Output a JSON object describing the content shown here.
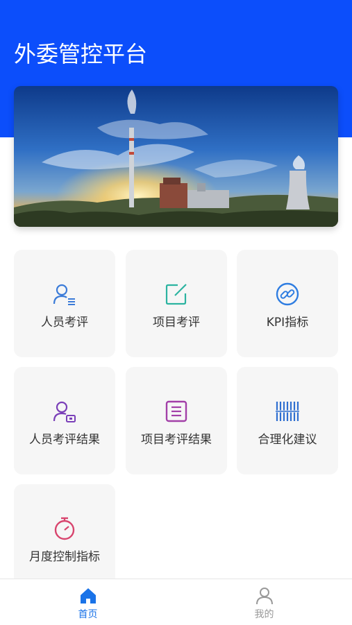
{
  "app": {
    "title": "外委管控平台"
  },
  "colors": {
    "header_blue": "#0c4efb",
    "active_tab": "#1a73e8",
    "inactive_tab": "#999999"
  },
  "banner": {
    "image": "power-plant-landscape-photo"
  },
  "menu": {
    "items": [
      {
        "label": "人员考评",
        "icon": "person-list-icon",
        "color": "#3b7bd8"
      },
      {
        "label": "项目考评",
        "icon": "edit-square-icon",
        "color": "#2bb3a0"
      },
      {
        "label": "KPI指标",
        "icon": "link-circle-icon",
        "color": "#2f7de1"
      },
      {
        "label": "人员考评结果",
        "icon": "person-badge-icon",
        "color": "#7a3fb8"
      },
      {
        "label": "项目考评结果",
        "icon": "document-box-icon",
        "color": "#a23fa8"
      },
      {
        "label": "合理化建议",
        "icon": "barcode-icon",
        "color": "#2f6fd0"
      },
      {
        "label": "月度控制指标",
        "icon": "stopwatch-icon",
        "color": "#d8456e"
      }
    ]
  },
  "tabbar": {
    "items": [
      {
        "label": "首页",
        "icon": "home-icon",
        "active": true
      },
      {
        "label": "我的",
        "icon": "user-icon",
        "active": false
      }
    ]
  }
}
